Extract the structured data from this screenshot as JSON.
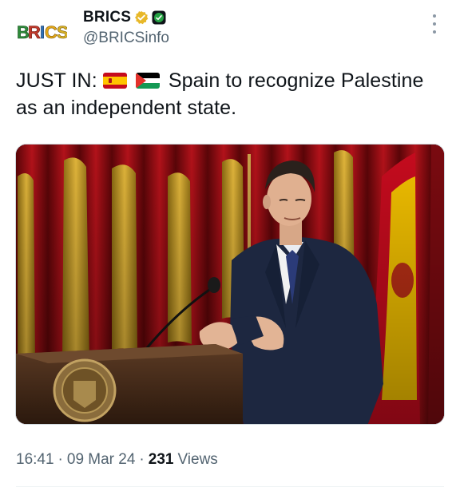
{
  "account": {
    "display_name": "BRICS",
    "handle": "@BRICSinfo",
    "avatar_text": "BRICS"
  },
  "post": {
    "text_prefix": "JUST IN:",
    "text_main": "Spain to recognize Palestine as an independent state.",
    "flags": [
      "spain-flag",
      "palestine-flag"
    ],
    "time": "16:41",
    "separator": "·",
    "date": "09 Mar 24",
    "views_count": "231",
    "views_label": "Views"
  },
  "colors": {
    "verified_gold": "#E8B829",
    "secondary_text": "#536471",
    "primary_text": "#0f1419"
  }
}
